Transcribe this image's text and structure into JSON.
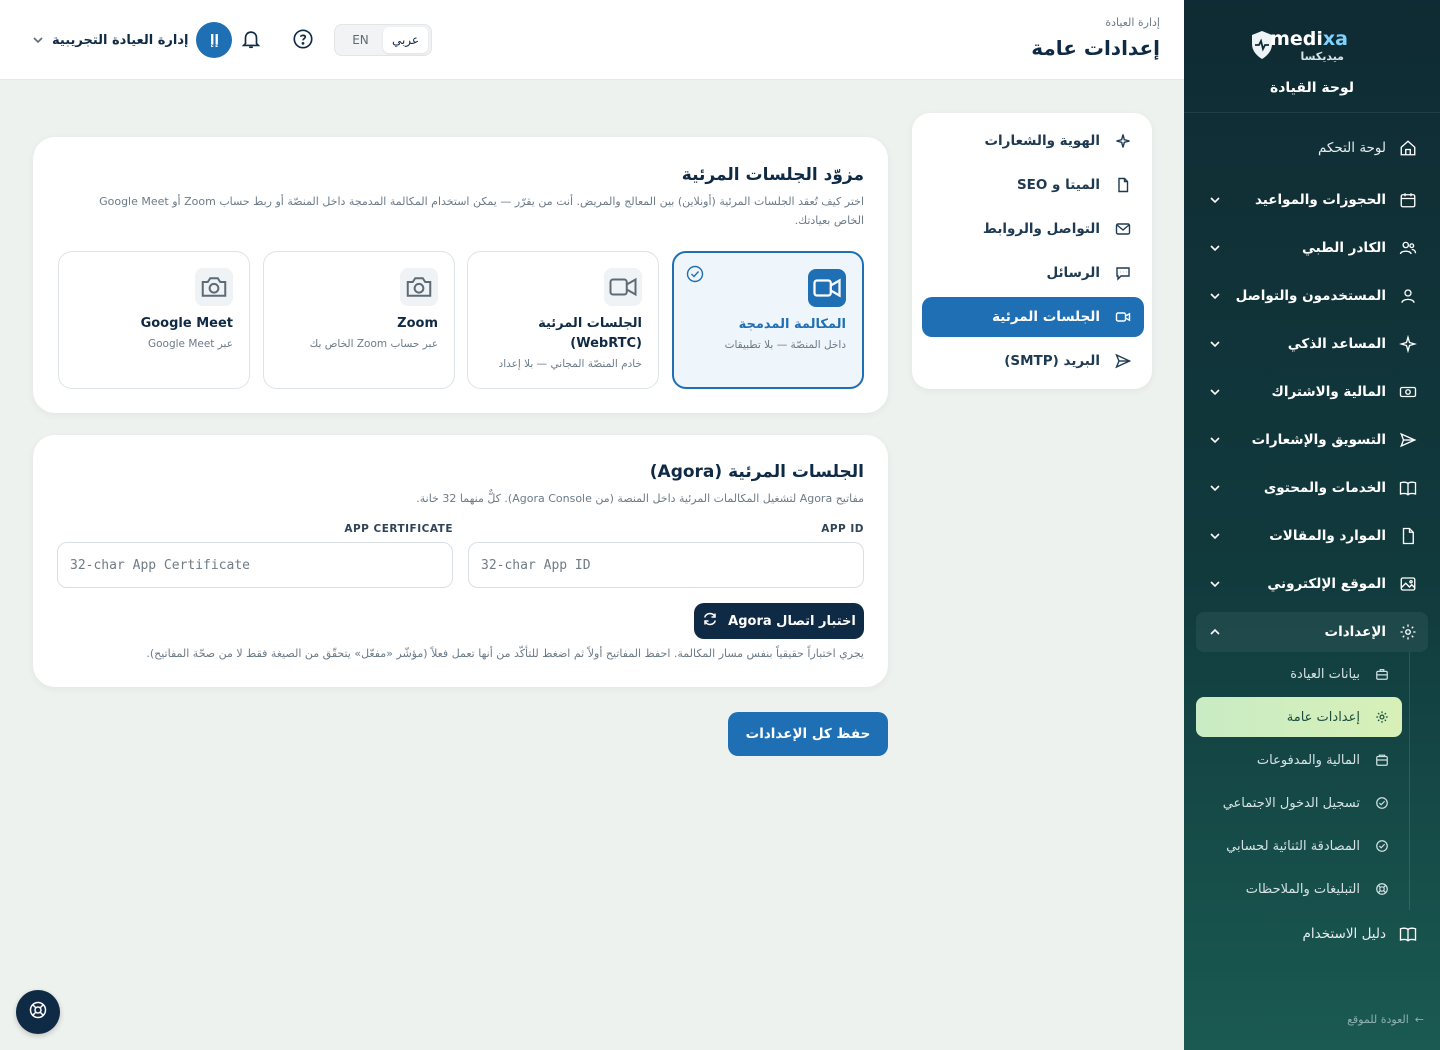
{
  "sidebar": {
    "brand_name_a": "medi",
    "brand_name_b": "xa",
    "brand_ar": "ميديكسا",
    "subtitle": "لوحة القيادة",
    "items": [
      {
        "label": "لوحة التحكم",
        "icon": "home-icon"
      },
      {
        "label": "الحجوزات والمواعيد",
        "icon": "calendar-icon"
      },
      {
        "label": "الكادر الطبي",
        "icon": "users-icon"
      },
      {
        "label": "المستخدمون والتواصل",
        "icon": "user-icon"
      },
      {
        "label": "المساعد الذكي",
        "icon": "sparkles-icon"
      },
      {
        "label": "المالية والاشتراك",
        "icon": "money-icon"
      },
      {
        "label": "التسويق والإشعارات",
        "icon": "send-icon"
      },
      {
        "label": "الخدمات والمحتوى",
        "icon": "book-icon"
      },
      {
        "label": "الموارد والمقالات",
        "icon": "file-icon"
      },
      {
        "label": "الموقع الإلكتروني",
        "icon": "image-icon"
      },
      {
        "label": "الإعدادات",
        "icon": "gear-icon"
      }
    ],
    "sub_items": [
      {
        "label": "بيانات العيادة",
        "icon": "building-icon"
      },
      {
        "label": "إعدادات عامة",
        "icon": "gear-icon"
      },
      {
        "label": "المالية والمدفوعات",
        "icon": "wallet-icon"
      },
      {
        "label": "تسجيل الدخول الاجتماعي",
        "icon": "check-circle-icon"
      },
      {
        "label": "المصادقة الثنائية لحسابي",
        "icon": "check-circle-icon"
      },
      {
        "label": "التبليغات والملاحظات",
        "icon": "lifebuoy-icon"
      }
    ],
    "guide": "دليل الاستخدام",
    "back_link": "العودة للموقع"
  },
  "topbar": {
    "breadcrumb": "إدارة العيادة",
    "title": "إعدادات عامة",
    "user_initials": "إإ",
    "user_name": "إدارة العيادة التجريبية",
    "lang_ar": "عربي",
    "lang_en": "EN",
    "active_lang": "ar"
  },
  "tabs": [
    {
      "label": "الهوية والشعارات",
      "icon": "sparkle-icon"
    },
    {
      "label": "الميتا و SEO",
      "icon": "file-icon"
    },
    {
      "label": "التواصل والروابط",
      "icon": "mail-icon"
    },
    {
      "label": "الرسائل",
      "icon": "chat-icon"
    },
    {
      "label": "الجلسات المرئية",
      "icon": "video-icon",
      "active": true
    },
    {
      "label": "البريد (SMTP)",
      "icon": "send-icon"
    }
  ],
  "provider_card": {
    "title": "مزوّد الجلسات المرئية",
    "desc_line1": "اختر كيف تُعقد الجلسات المرئية (أونلاين) بين المعالج والمريض. أنت من يقرّر — يمكن استخدام المكالمة المدمجة داخل المنصّة أو ربط حساب Zoom أو Google Meet",
    "desc_line2": "الخاص بعيادتك.",
    "providers": [
      {
        "name": "المكالمة المدمجة",
        "sub": "داخل المنصّة — بلا تطبيقات",
        "icon": "video-icon",
        "selected": true
      },
      {
        "name": "الجلسات المرئية (WebRTC)",
        "sub": "خادم المنصّة المجاني — بلا إعداد",
        "icon": "video-icon",
        "selected": false
      },
      {
        "name": "Zoom",
        "sub": "عبر حساب Zoom الخاص بك",
        "icon": "camera-icon",
        "selected": false
      },
      {
        "name": "Google Meet",
        "sub": "عبر Google Meet",
        "icon": "camera-icon",
        "selected": false
      }
    ]
  },
  "agora_card": {
    "title": "الجلسات المرئية (Agora)",
    "desc": "مفاتيح Agora لتشغيل المكالمات المرئية داخل المنصة (من Agora Console). كلٌّ منهما 32 خانة.",
    "app_id_label": "APP ID",
    "app_id_placeholder": "32-char App ID",
    "app_id_value": "",
    "cert_label": "APP CERTIFICATE",
    "cert_placeholder": "32-char App Certificate",
    "cert_value": "",
    "test_button": "اختبار اتصال Agora",
    "note": "يجري اختباراً حقيقياً بنفس مسار المكالمة. احفظ المفاتيح أولاً ثم اضغط للتأكّد من أنها تعمل فعلاً (مؤشّر «مفعّل» يتحقّق من الصيغة فقط لا من صحّة المفاتيح)."
  },
  "save_button": "حفظ كل الإعدادات",
  "colors": {
    "primary": "#1f6fb5",
    "navy": "#0f2a44",
    "sidebar_bg": "#0f2b33",
    "active_sub": "#c9ecc4"
  }
}
